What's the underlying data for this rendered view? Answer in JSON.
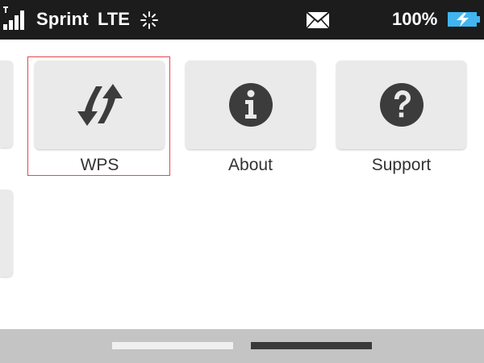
{
  "status_bar": {
    "carrier": "Sprint",
    "network": "LTE",
    "battery_percent": "100%",
    "icons": [
      "signal-icon",
      "sync-activity-icon",
      "mail-icon",
      "battery-charging-icon"
    ],
    "colors": {
      "background": "#1c1c1c",
      "text": "#ffffff",
      "battery_fill": "#41b5f0"
    }
  },
  "menu": {
    "items": [
      {
        "label": "WPS",
        "icon": "wps-icon",
        "focused": true
      },
      {
        "label": "About",
        "icon": "info-icon",
        "focused": false
      },
      {
        "label": "Support",
        "icon": "help-icon",
        "focused": false
      }
    ]
  },
  "pager": {
    "pages": 2,
    "current_page": 2
  },
  "colors": {
    "tile": "#ebeaea",
    "icon": "#3c3c3c",
    "focus": "#e2484f"
  }
}
